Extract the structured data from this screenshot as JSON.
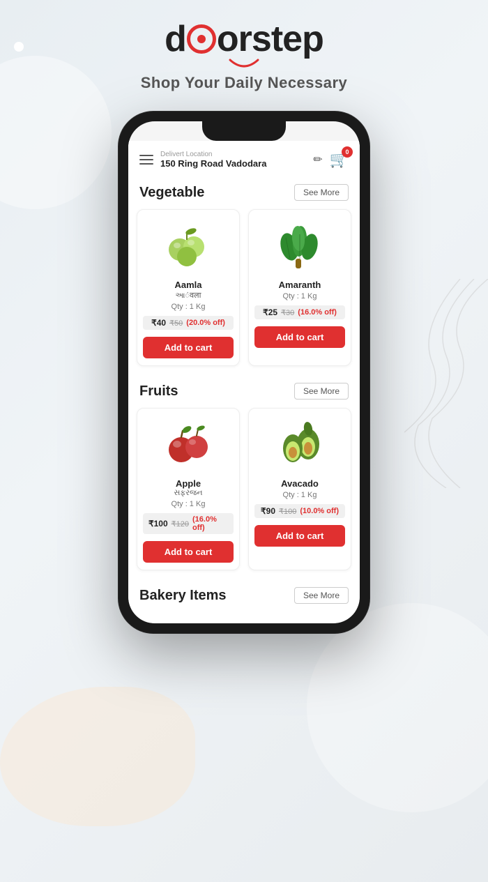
{
  "app": {
    "logo": "doorstep",
    "tagline": "Shop Your Daily Necessary"
  },
  "phone": {
    "location_label": "Delivert Location",
    "location_address": "150 Ring Road Vadodara",
    "cart_count": "0"
  },
  "sections": [
    {
      "id": "vegetable",
      "title": "Vegetable",
      "see_more_label": "See More",
      "products": [
        {
          "id": "aamla",
          "name": "Aamla",
          "name_sub": "આंवला",
          "qty": "Qty : 1 Kg",
          "price_current": "₹40",
          "price_old": "₹50",
          "discount": "(20.0% off)",
          "add_to_cart": "Add to cart",
          "emoji": "🍈"
        },
        {
          "id": "amaranth",
          "name": "Amaranth",
          "name_sub": "",
          "qty": "Qty : 1 Kg",
          "price_current": "₹25",
          "price_old": "₹30",
          "discount": "(16.0% off)",
          "add_to_cart": "Add to cart",
          "emoji": "🌿"
        }
      ]
    },
    {
      "id": "fruits",
      "title": "Fruits",
      "see_more_label": "See More",
      "products": [
        {
          "id": "apple",
          "name": "Apple",
          "name_sub": "સફરજન",
          "qty": "Qty : 1 Kg",
          "price_current": "₹100",
          "price_old": "₹120",
          "discount": "(16.0% off)",
          "add_to_cart": "Add to cart",
          "emoji": "🍎"
        },
        {
          "id": "avacado",
          "name": "Avacado",
          "name_sub": "",
          "qty": "Qty : 1 Kg",
          "price_current": "₹90",
          "price_old": "₹100",
          "discount": "(10.0% off)",
          "add_to_cart": "Add to cart",
          "emoji": "🥑"
        }
      ]
    },
    {
      "id": "bakery",
      "title": "Bakery Items",
      "see_more_label": "See More",
      "products": []
    }
  ]
}
